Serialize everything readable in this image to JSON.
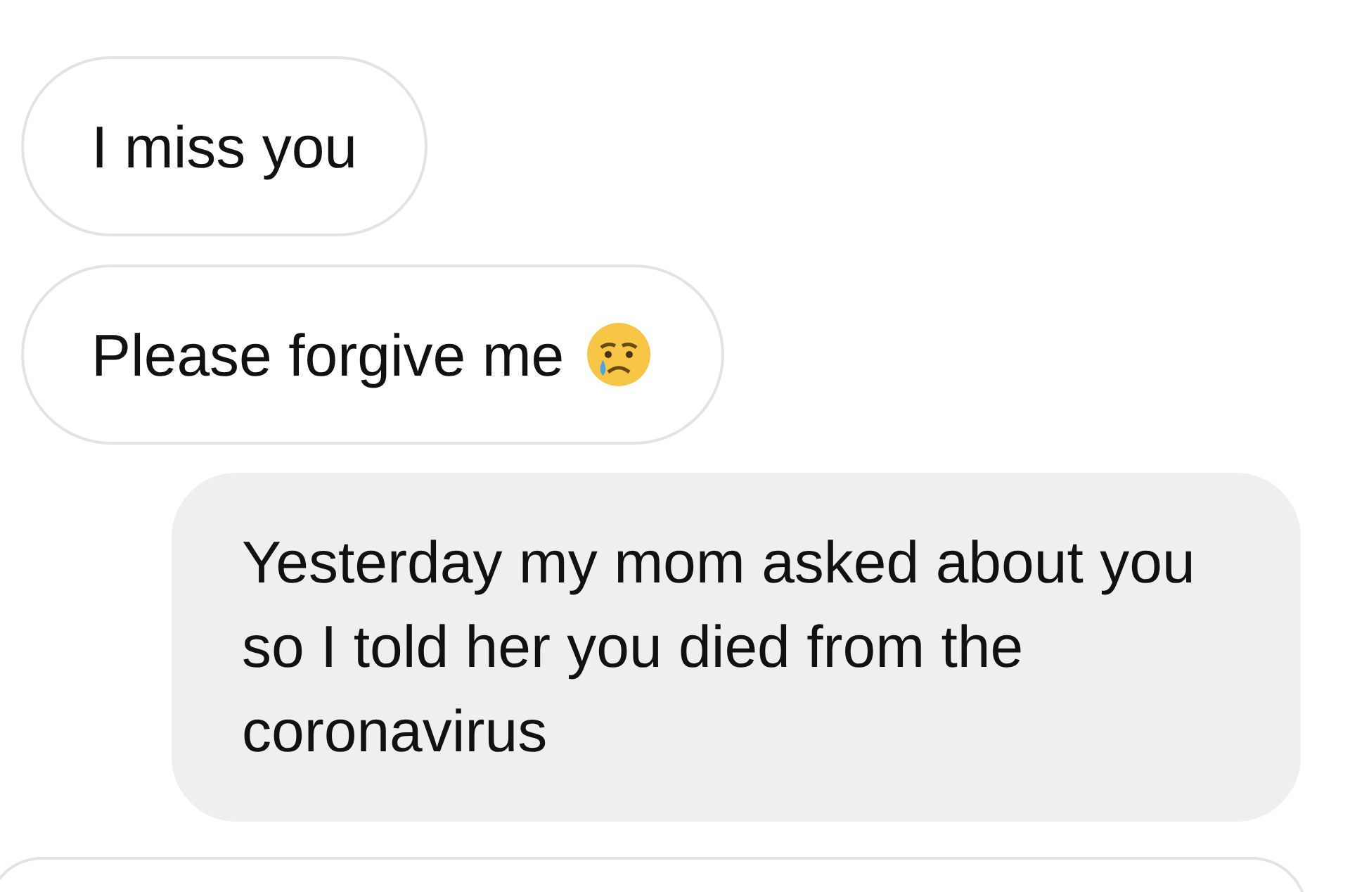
{
  "messages": [
    {
      "kind": "received",
      "text": "I miss you",
      "has_emoji": false
    },
    {
      "kind": "received",
      "text": "Please forgive me",
      "has_emoji": true
    },
    {
      "kind": "sent",
      "text": "Yesterday my mom asked about you so I told her you died from the coronavirus",
      "has_emoji": false
    },
    {
      "kind": "received_partial",
      "has_emoji": false
    }
  ]
}
